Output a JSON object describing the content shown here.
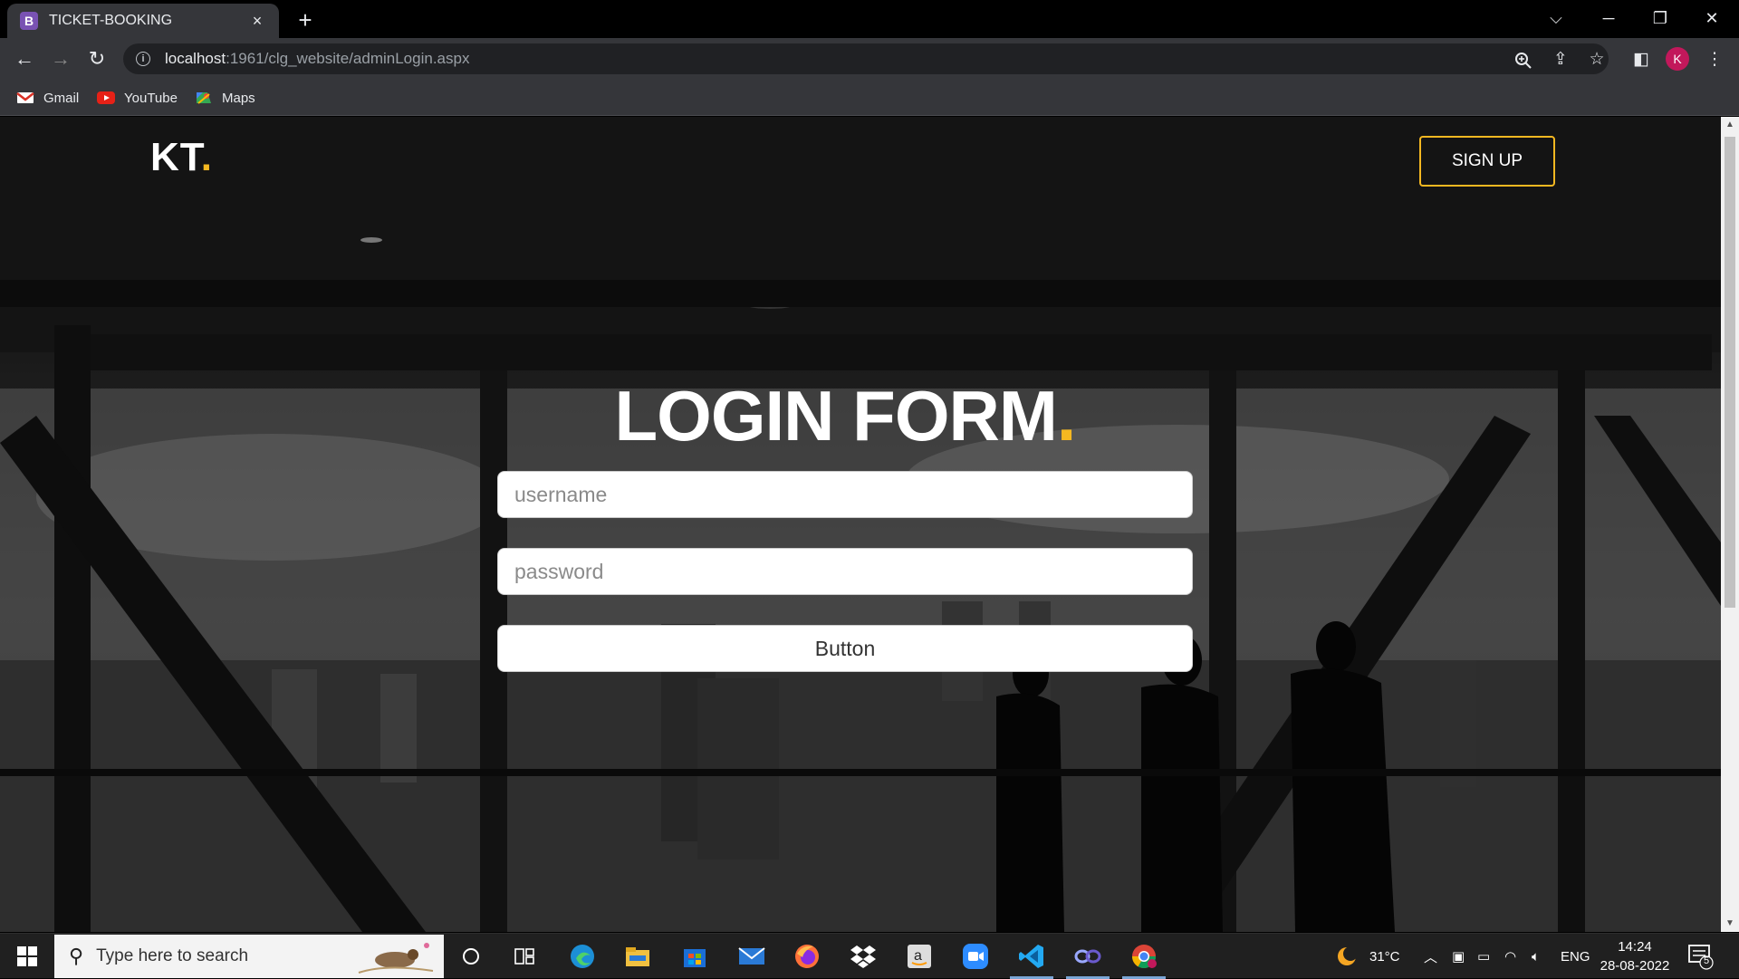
{
  "browser": {
    "tab_title": "TICKET-BOOKING",
    "tab_favicon": "B",
    "tab_close": "×",
    "new_tab": "+",
    "url_host": "localhost",
    "url_path": ":1961/clg_website/adminLogin.aspx",
    "profile_initial": "K",
    "bookmarks": [
      {
        "label": "Gmail",
        "icon": "gmail-icon"
      },
      {
        "label": "YouTube",
        "icon": "youtube-icon"
      },
      {
        "label": "Maps",
        "icon": "maps-icon"
      }
    ]
  },
  "page": {
    "logo_text": "KT",
    "logo_dot": ".",
    "signup_label": "SIGN UP",
    "heading_text": "LOGIN FORM",
    "heading_dot": ".",
    "username_placeholder": "username",
    "password_placeholder": "password",
    "button_label": "Button",
    "accent_color": "#f5b821"
  },
  "taskbar": {
    "search_placeholder": "Type here to search",
    "weather": "31°C",
    "language": "ENG",
    "time": "14:24",
    "date": "28-08-2022",
    "notification_count": "5",
    "apps": [
      "cortana-icon",
      "task-view-icon",
      "edge-icon",
      "file-explorer-icon",
      "store-icon",
      "mail-icon",
      "firefox-icon",
      "dropbox-icon",
      "amazon-icon",
      "zoom-icon",
      "vscode-icon",
      "app-icon",
      "chrome-icon"
    ]
  }
}
